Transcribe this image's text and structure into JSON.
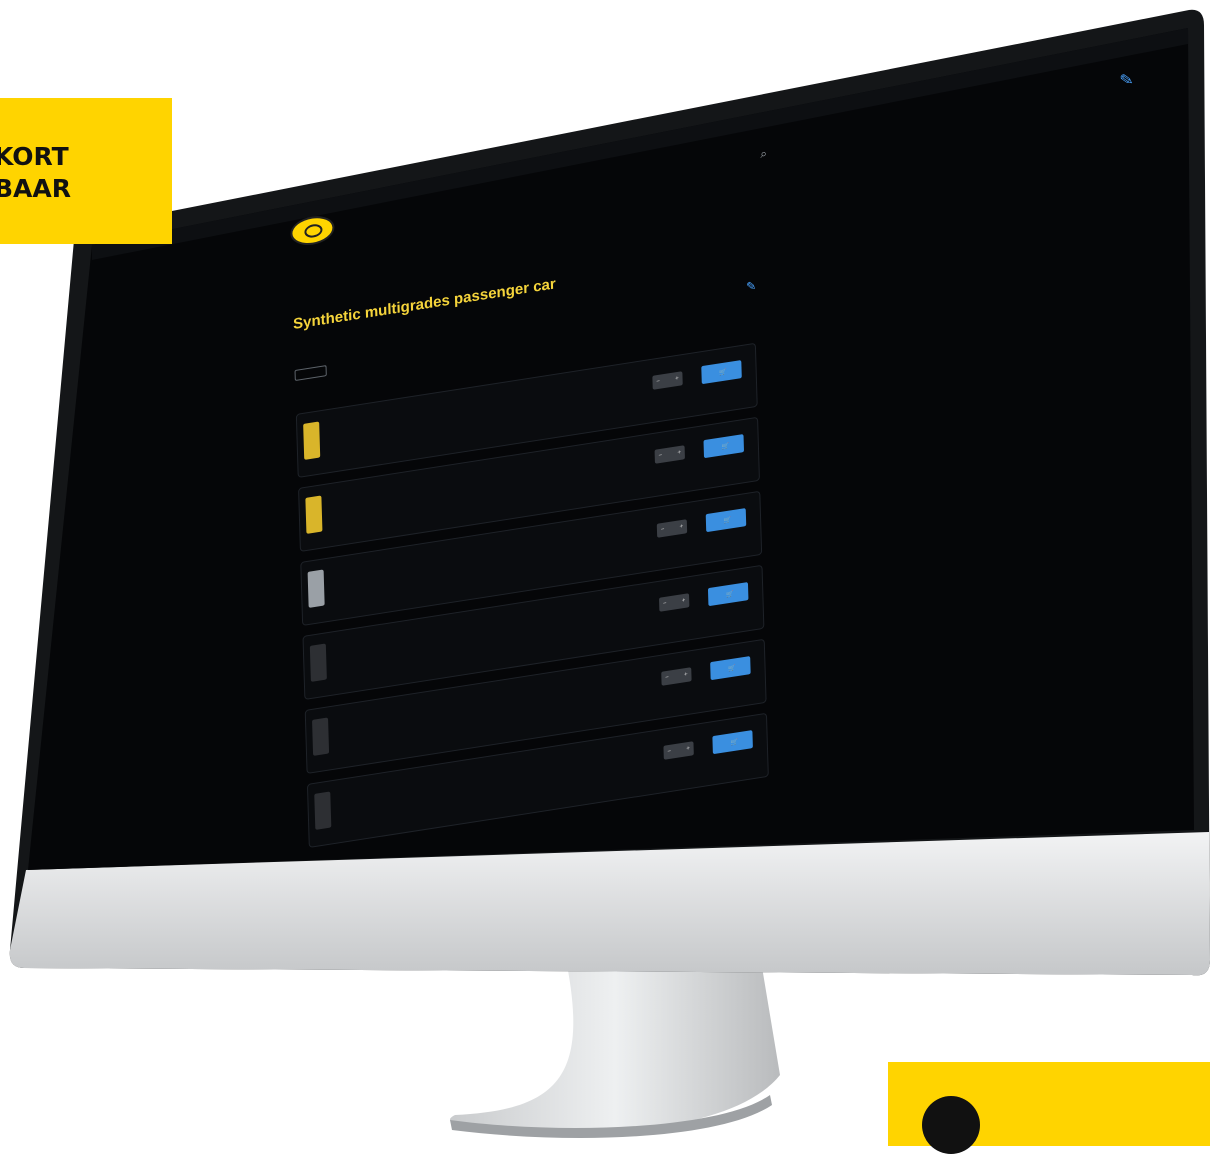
{
  "promo": {
    "line1": "KORT",
    "line2": "BAAR"
  },
  "top_strip": "",
  "top_right_label": "",
  "brand_text": "",
  "nav": [
    {
      "label": ""
    },
    {
      "label": ""
    },
    {
      "label": ""
    },
    {
      "label": ""
    }
  ],
  "breadcrumb": "",
  "page_title": "Synthetic multigrades passenger car",
  "meta_right": "",
  "meta_label": "",
  "filter_label": "",
  "rows_label": "",
  "products": [
    {
      "name": "",
      "code": "",
      "pack": "",
      "price": "",
      "qty": "",
      "stock": "",
      "order_label": "",
      "thumb": "yellow"
    },
    {
      "name": "",
      "code": "",
      "pack": "",
      "price": "",
      "qty": "",
      "stock": "",
      "order_label": "",
      "thumb": "yellow"
    },
    {
      "name": "",
      "code": "",
      "pack": "",
      "price": "",
      "qty": "",
      "stock": "",
      "order_label": "",
      "thumb": "silver"
    },
    {
      "name": "",
      "code": "",
      "pack": "",
      "price": "",
      "qty": "",
      "stock": "",
      "order_label": "",
      "thumb": "dark"
    },
    {
      "name": "",
      "code": "",
      "pack": "",
      "price": "",
      "qty": "",
      "stock": "",
      "order_label": "",
      "thumb": "dark"
    },
    {
      "name": "",
      "code": "",
      "pack": "",
      "price": "",
      "qty": "",
      "stock": "",
      "order_label": "",
      "thumb": "dark"
    }
  ],
  "colors": {
    "accent_yellow": "#ffd400",
    "title_yellow": "#f5d43b",
    "button_blue": "#3a8fe0",
    "screen_black": "#050608",
    "bezel_silver": "#d9dadb"
  }
}
